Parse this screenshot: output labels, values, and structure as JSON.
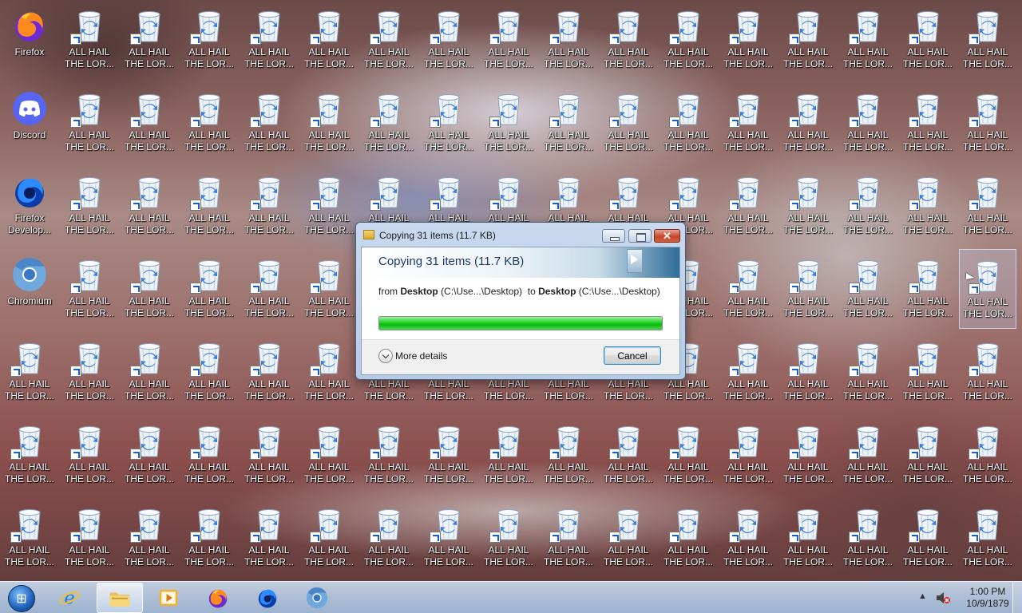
{
  "desktop": {
    "apps": [
      {
        "label": "Firefox",
        "icon": "firefox-icon"
      },
      {
        "label": "Discord",
        "icon": "discord-icon"
      },
      {
        "label": "Firefox Develop...",
        "icon": "firefox-developer-icon"
      },
      {
        "label": "Chromium",
        "icon": "chromium-icon"
      }
    ],
    "bin_label": "ALL HAIL\nTHE LOR...",
    "bin_icon": "recycle-bin-icon"
  },
  "dialog": {
    "window_title": "Copying 31 items (11.7 KB)",
    "heading": "Copying 31 items (11.7 KB)",
    "from_label": "from",
    "from_name": "Desktop",
    "from_path": "(C:\\Use...\\Desktop)",
    "to_label": "to",
    "to_name": "Desktop",
    "to_path": "(C:\\Use...\\Desktop)",
    "progress_fraction": 1.0,
    "more_details": "More details",
    "cancel": "Cancel",
    "close_glyph": "✕"
  },
  "taskbar": {
    "pinned": [
      {
        "name": "internet-explorer",
        "icon": "internet-explorer-icon",
        "active": false
      },
      {
        "name": "file-explorer",
        "icon": "folder-icon",
        "active": true
      },
      {
        "name": "media-player",
        "icon": "media-player-icon",
        "active": false
      },
      {
        "name": "firefox",
        "icon": "firefox-icon",
        "active": false
      },
      {
        "name": "firefox-developer",
        "icon": "firefox-developer-icon",
        "active": false
      },
      {
        "name": "chromium",
        "icon": "chromium-icon",
        "active": false
      }
    ],
    "clock_time": "1:00 PM",
    "clock_date": "10/9/1879"
  },
  "colors": {
    "progress_green": "#22d22a",
    "taskbar": "#a8bfdc",
    "dialog_frame": "#b5cbe6"
  }
}
